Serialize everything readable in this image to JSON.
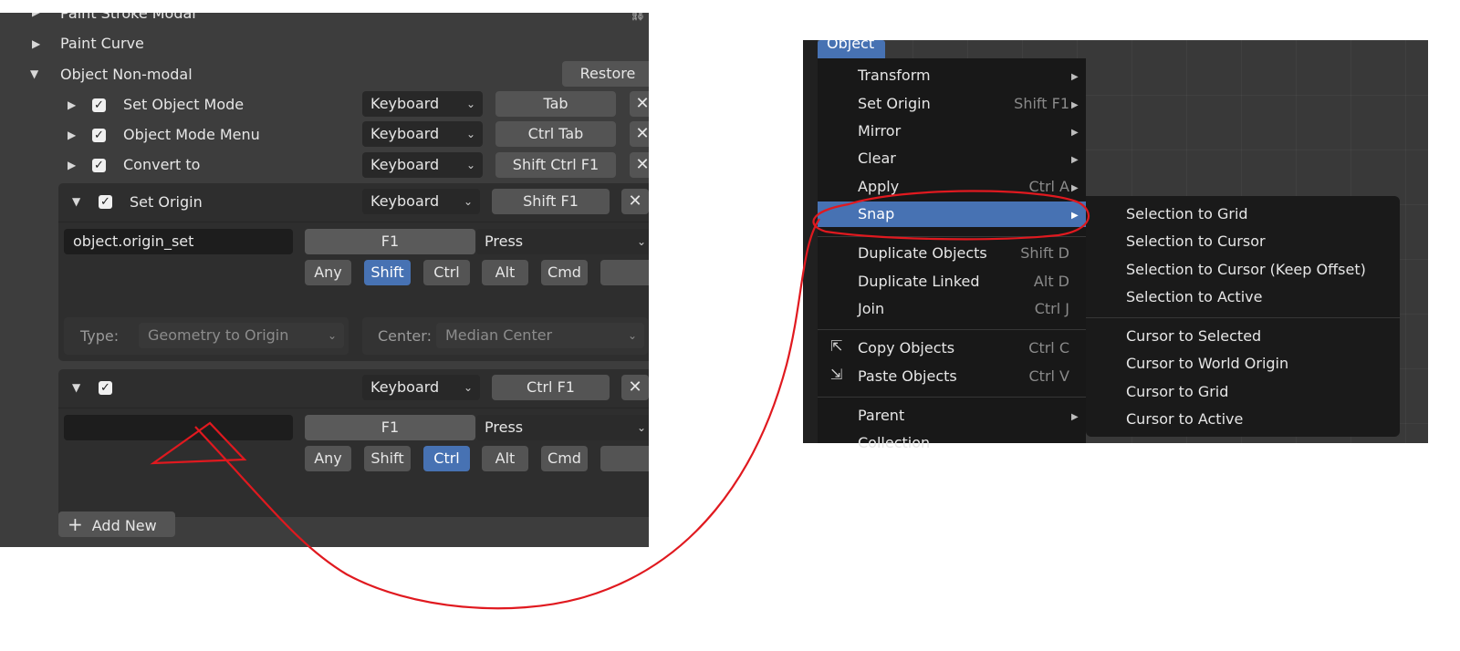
{
  "keymap": {
    "cut_top_label": "Paint Stroke Modal",
    "paint_curve": "Paint Curve",
    "section_title": "Object Non-modal",
    "restore_label": "Restore",
    "rows": [
      {
        "name": "Set Object Mode",
        "input": "Keyboard",
        "key": "Tab"
      },
      {
        "name": "Object Mode Menu",
        "input": "Keyboard",
        "key": "Ctrl Tab"
      },
      {
        "name": "Convert to",
        "input": "Keyboard",
        "key": "Shift Ctrl F1"
      }
    ],
    "expanded1": {
      "name": "Set Origin",
      "input": "Keyboard",
      "key": "Shift F1",
      "operator": "object.origin_set",
      "key_field": "F1",
      "event": "Press",
      "modifiers": [
        "Any",
        "Shift",
        "Ctrl",
        "Alt",
        "Cmd"
      ],
      "active_modifier": "Shift",
      "type_label": "Type:",
      "type_value": "Geometry to Origin",
      "center_label": "Center:",
      "center_value": "Median Center"
    },
    "expanded2": {
      "name": "",
      "input": "Keyboard",
      "key": "Ctrl F1",
      "operator": "",
      "key_field": "F1",
      "event": "Press",
      "modifiers": [
        "Any",
        "Shift",
        "Ctrl",
        "Alt",
        "Cmd"
      ],
      "active_modifier": "Ctrl"
    },
    "add_new": "Add New"
  },
  "menu": {
    "header": "Object",
    "items": [
      {
        "label": "Transform",
        "shortcut": ""
      },
      {
        "label": "Set Origin",
        "shortcut": "Shift F1"
      },
      {
        "label": "Mirror",
        "shortcut": ""
      },
      {
        "label": "Clear",
        "shortcut": ""
      },
      {
        "label": "Apply",
        "shortcut": "Ctrl A"
      },
      {
        "label": "Snap",
        "shortcut": ""
      },
      {
        "label": "Duplicate Objects",
        "shortcut": "Shift D"
      },
      {
        "label": "Duplicate Linked",
        "shortcut": "Alt D"
      },
      {
        "label": "Join",
        "shortcut": "Ctrl J"
      },
      {
        "label": "Copy Objects",
        "shortcut": "Ctrl C"
      },
      {
        "label": "Paste Objects",
        "shortcut": "Ctrl V"
      },
      {
        "label": "Parent",
        "shortcut": ""
      },
      {
        "label": "Collection",
        "shortcut": ""
      }
    ],
    "snap_submenu": [
      "Selection to Grid",
      "Selection to Cursor",
      "Selection to Cursor (Keep Offset)",
      "Selection to Active",
      "Cursor to Selected",
      "Cursor to World Origin",
      "Cursor to Grid",
      "Cursor to Active"
    ]
  },
  "colors": {
    "panel_bg": "#3d3d3d",
    "menu_bg": "#181818",
    "highlight": "#4772b3",
    "annotation": "#e0191f"
  }
}
